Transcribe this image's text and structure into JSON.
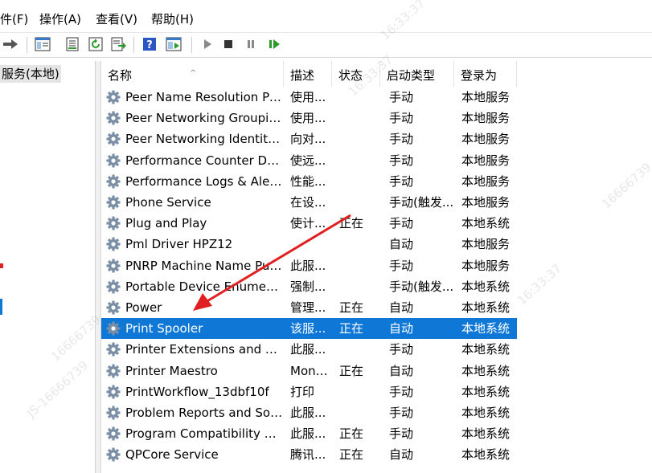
{
  "menu": {
    "file_fragment": "件(F)",
    "action": "操作(A)",
    "view": "查看(V)",
    "help": "帮助(H)"
  },
  "toolbar": {
    "icons": [
      "forward-arrow-icon",
      "console-tree-icon",
      "properties-icon",
      "refresh-icon",
      "export-list-icon",
      "help-icon",
      "view-icon",
      "play-icon",
      "stop-icon",
      "pause-icon",
      "resume-icon"
    ]
  },
  "tree": {
    "selected_label": "服务(本地)"
  },
  "list": {
    "columns": [
      "名称",
      "描述",
      "状态",
      "启动类型",
      "登录为"
    ],
    "sort_indicator": "^",
    "rows": [
      {
        "name": "Peer Name Resolution Pro...",
        "desc": "使用...",
        "status": "",
        "type": "手动",
        "logon": "本地服务"
      },
      {
        "name": "Peer Networking Grouping",
        "desc": "使用...",
        "status": "",
        "type": "手动",
        "logon": "本地服务"
      },
      {
        "name": "Peer Networking Identity ...",
        "desc": "向对...",
        "status": "",
        "type": "手动",
        "logon": "本地服务"
      },
      {
        "name": "Performance Counter DLL ...",
        "desc": "使远...",
        "status": "",
        "type": "手动",
        "logon": "本地服务"
      },
      {
        "name": "Performance Logs & Alerts",
        "desc": "性能...",
        "status": "",
        "type": "手动",
        "logon": "本地服务"
      },
      {
        "name": "Phone Service",
        "desc": "在设...",
        "status": "",
        "type": "手动(触发...",
        "logon": "本地服务"
      },
      {
        "name": "Plug and Play",
        "desc": "使计...",
        "status": "正在",
        "type": "手动",
        "logon": "本地系统"
      },
      {
        "name": "Pml Driver HPZ12",
        "desc": "",
        "status": "",
        "type": "自动",
        "logon": "本地服务"
      },
      {
        "name": "PNRP Machine Name Publ...",
        "desc": "此服...",
        "status": "",
        "type": "手动",
        "logon": "本地服务"
      },
      {
        "name": "Portable Device Enumerat...",
        "desc": "强制...",
        "status": "",
        "type": "手动(触发...",
        "logon": "本地系统"
      },
      {
        "name": "Power",
        "desc": "管理...",
        "status": "正在",
        "type": "自动",
        "logon": "本地系统"
      },
      {
        "name": "Print Spooler",
        "desc": "该服...",
        "status": "正在",
        "type": "自动",
        "logon": "本地系统",
        "selected": true
      },
      {
        "name": "Printer Extensions and Noti...",
        "desc": "此服...",
        "status": "",
        "type": "手动",
        "logon": "本地系统"
      },
      {
        "name": "Printer Maestro",
        "desc": "Moni...",
        "status": "正在",
        "type": "自动",
        "logon": "本地系统"
      },
      {
        "name": "PrintWorkflow_13dbf10f",
        "desc": "打印",
        "status": "",
        "type": "手动",
        "logon": "本地系统"
      },
      {
        "name": "Problem Reports and Solut...",
        "desc": "此服...",
        "status": "",
        "type": "手动",
        "logon": "本地系统"
      },
      {
        "name": "Program Compatibility Assi...",
        "desc": "此服...",
        "status": "正在",
        "type": "手动",
        "logon": "本地系统"
      },
      {
        "name": "QPCore Service",
        "desc": "腾讯...",
        "status": "正在",
        "type": "自动",
        "logon": "本地系统"
      }
    ]
  },
  "colors": {
    "selection": "#0f78d7",
    "annotation_arrow": "#e02020"
  },
  "watermark_texts": [
    "16:33:37",
    "16666739",
    "16:33:37",
    "JS-16666739",
    "16666739",
    "16:33:37"
  ]
}
